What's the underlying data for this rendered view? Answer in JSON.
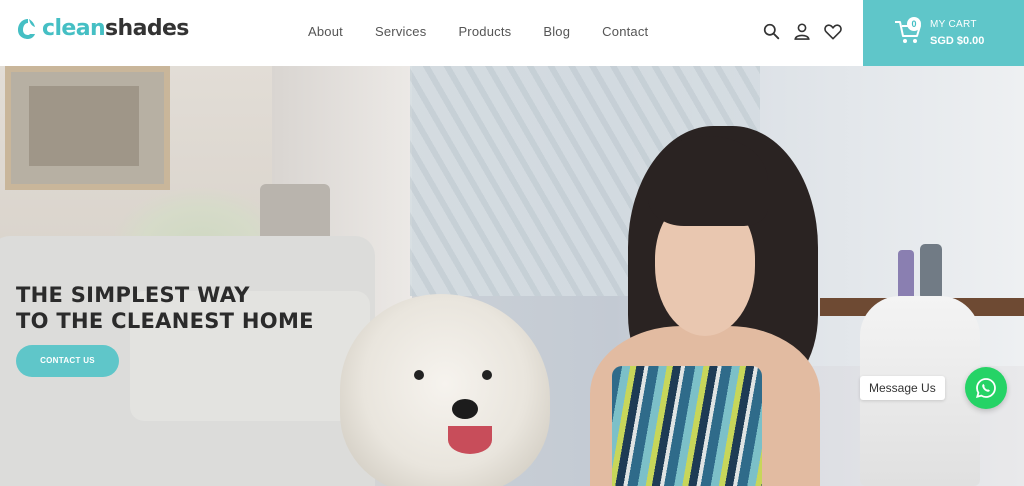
{
  "brand": {
    "part1": "clean",
    "part2": "shades",
    "color": "#45bfc4"
  },
  "nav": {
    "items": [
      "About",
      "Services",
      "Products",
      "Blog",
      "Contact"
    ]
  },
  "icons": [
    "search-icon",
    "user-icon",
    "heart-icon"
  ],
  "cart": {
    "label": "MY CART",
    "total": "SGD $0.00",
    "count": "0",
    "color": "#5fc6c9"
  },
  "hero": {
    "title_line1": "THE SIMPLEST WAY",
    "title_line2": "TO THE CLEANEST HOME",
    "button_label": "CONTACT US"
  },
  "chat": {
    "tooltip": "Message Us",
    "icon": "whatsapp-icon",
    "color": "#25d366"
  }
}
